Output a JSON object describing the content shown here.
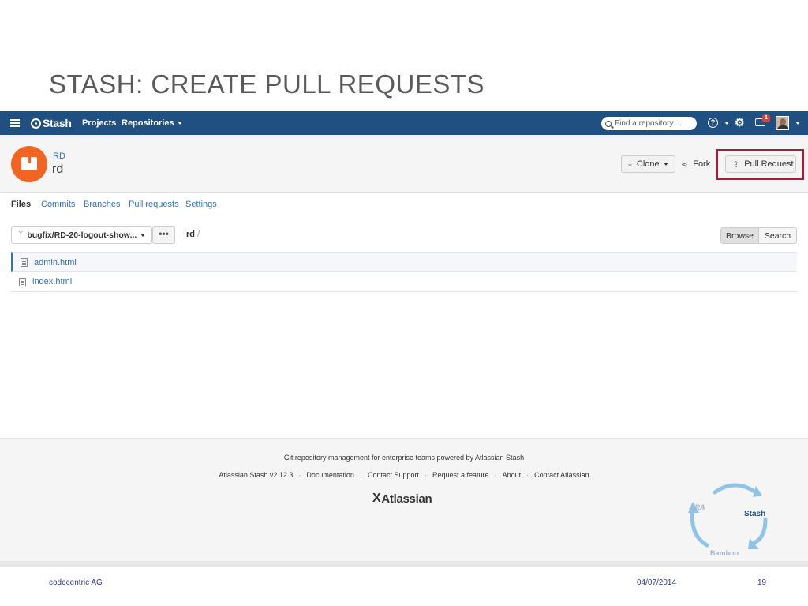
{
  "slide": {
    "title": "STASH: CREATE PULL REQUESTS",
    "footer_company": "codecentric AG",
    "footer_date": "04/07/2014",
    "footer_page": "19"
  },
  "header": {
    "logo": "Stash",
    "nav_projects": "Projects",
    "nav_repositories": "Repositories",
    "search_placeholder": "Find a repository...",
    "notification_count": "1"
  },
  "repo": {
    "project": "RD",
    "name": "rd",
    "clone_label": "Clone",
    "fork_label": "Fork",
    "pull_request_label": "Pull Request"
  },
  "tabs": [
    {
      "label": "Files"
    },
    {
      "label": "Commits"
    },
    {
      "label": "Branches"
    },
    {
      "label": "Pull requests"
    },
    {
      "label": "Settings"
    }
  ],
  "browser": {
    "branch": "bugfix/RD-20-logout-show...",
    "more": "•••",
    "path_repo": "rd",
    "path_sep": "/",
    "browse_label": "Browse",
    "search_label": "Search"
  },
  "files": [
    {
      "name": "admin.html"
    },
    {
      "name": "index.html"
    }
  ],
  "footer": {
    "tagline": "Git repository management for enterprise teams powered by Atlassian Stash",
    "links": [
      "Atlassian Stash v2.12.3",
      "Documentation",
      "Contact Support",
      "Request a feature",
      "About",
      "Contact Atlassian"
    ],
    "brand": "Atlassian",
    "cycle_jira": "JIRA",
    "cycle_stash": "Stash",
    "cycle_bamboo": "Bamboo"
  },
  "icons": {
    "menu": "menu-icon",
    "search": "search-icon",
    "help": "help-icon",
    "settings": "gear-icon",
    "inbox": "inbox-icon",
    "clone": "download-icon",
    "fork": "fork-icon",
    "pull_request": "upload-icon",
    "branch": "branch-icon",
    "file": "file-icon"
  },
  "colors": {
    "header_bg": "#205081",
    "link": "#3572b0",
    "repo_avatar": "#f26422",
    "highlight": "#a61e3c"
  }
}
